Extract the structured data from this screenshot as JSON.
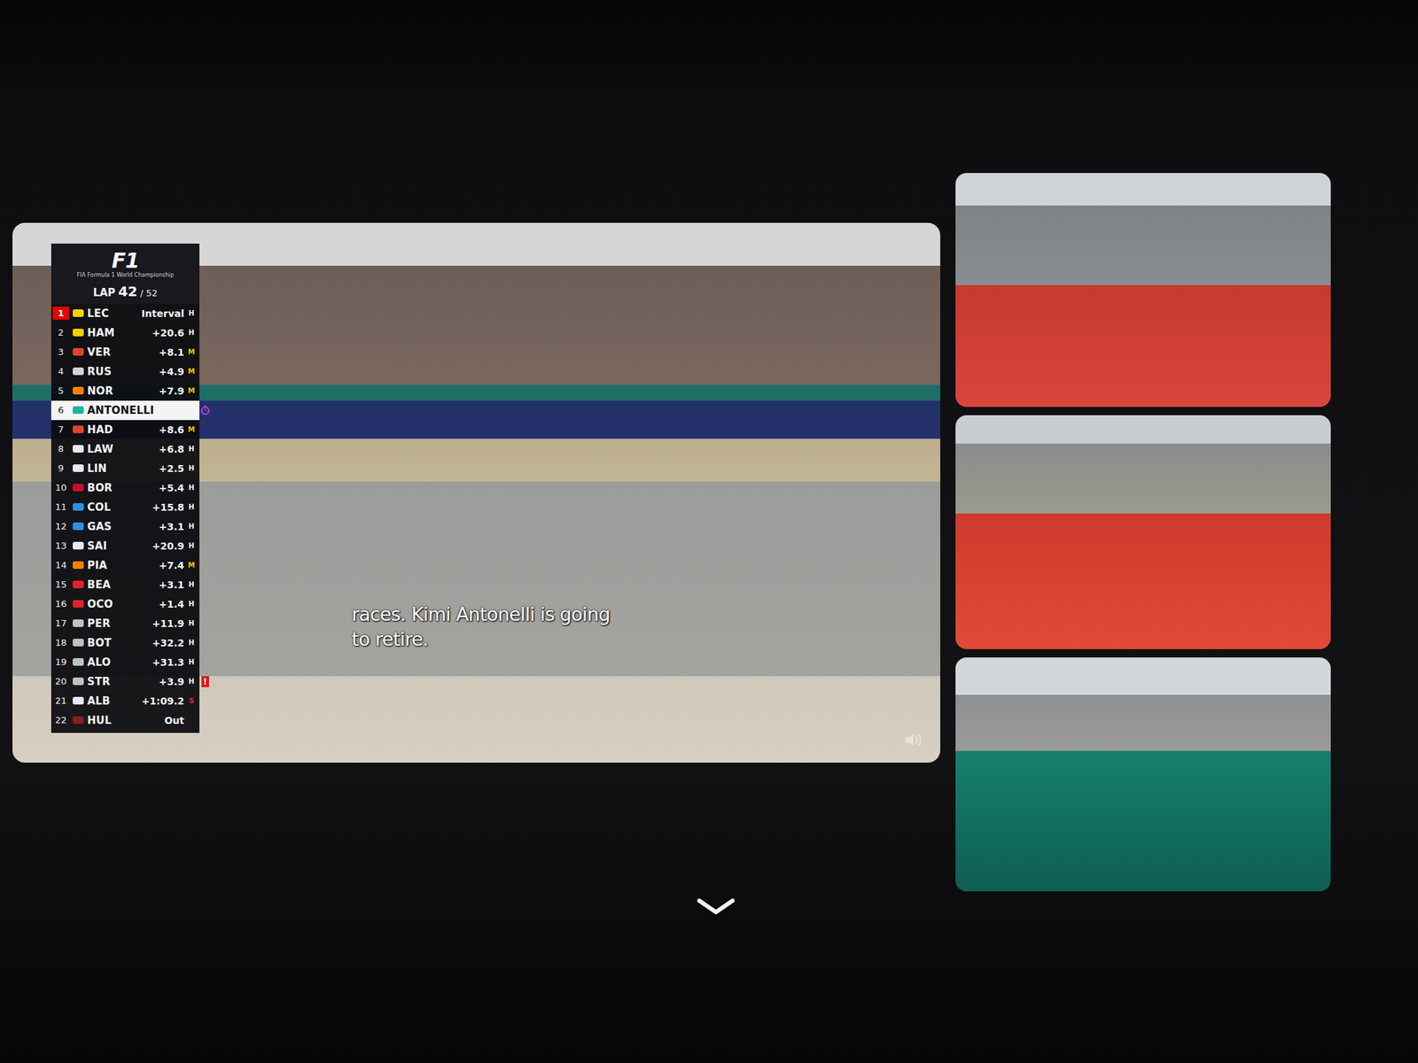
{
  "main_video": {
    "timing_tower": {
      "logo": "F1",
      "logo_subtitle": "FIA Formula 1 World Championship",
      "lap_label": "LAP",
      "lap_current": "42",
      "lap_total": "/ 52",
      "rows": [
        {
          "pos": "1",
          "code": "LEC",
          "interval": "Interval",
          "tyre": "H",
          "color": "#f5d000",
          "leader": true,
          "selected": false,
          "flag": "",
          "timer_icon": false
        },
        {
          "pos": "2",
          "code": "HAM",
          "interval": "+20.6",
          "tyre": "H",
          "color": "#f5d000",
          "leader": false,
          "selected": false,
          "flag": "",
          "timer_icon": false
        },
        {
          "pos": "3",
          "code": "VER",
          "interval": "+8.1",
          "tyre": "M",
          "color": "#e0442b",
          "leader": false,
          "selected": false,
          "flag": "",
          "timer_icon": false
        },
        {
          "pos": "4",
          "code": "RUS",
          "interval": "+4.9",
          "tyre": "M",
          "color": "#d0d4d8",
          "leader": false,
          "selected": false,
          "flag": "",
          "timer_icon": false
        },
        {
          "pos": "5",
          "code": "NOR",
          "interval": "+7.9",
          "tyre": "M",
          "color": "#ff8000",
          "leader": false,
          "selected": false,
          "flag": "",
          "timer_icon": false
        },
        {
          "pos": "6",
          "code": "ANTONELLI",
          "interval": "",
          "tyre": "",
          "color": "#1fb5a0",
          "leader": false,
          "selected": true,
          "flag": "",
          "timer_icon": true
        },
        {
          "pos": "7",
          "code": "HAD",
          "interval": "+8.6",
          "tyre": "M",
          "color": "#e0442b",
          "leader": false,
          "selected": false,
          "flag": "",
          "timer_icon": false
        },
        {
          "pos": "8",
          "code": "LAW",
          "interval": "+6.8",
          "tyre": "H",
          "color": "#e8e8f0",
          "leader": false,
          "selected": false,
          "flag": "",
          "timer_icon": false
        },
        {
          "pos": "9",
          "code": "LIN",
          "interval": "+2.5",
          "tyre": "H",
          "color": "#e8e8f0",
          "leader": false,
          "selected": false,
          "flag": "",
          "timer_icon": false
        },
        {
          "pos": "10",
          "code": "BOR",
          "interval": "+5.4",
          "tyre": "H",
          "color": "#c8102e",
          "leader": false,
          "selected": false,
          "flag": "",
          "timer_icon": false
        },
        {
          "pos": "11",
          "code": "COL",
          "interval": "+15.8",
          "tyre": "H",
          "color": "#2f8fe0",
          "leader": false,
          "selected": false,
          "flag": "",
          "timer_icon": false
        },
        {
          "pos": "12",
          "code": "GAS",
          "interval": "+3.1",
          "tyre": "H",
          "color": "#2f8fe0",
          "leader": false,
          "selected": false,
          "flag": "",
          "timer_icon": false
        },
        {
          "pos": "13",
          "code": "SAI",
          "interval": "+20.9",
          "tyre": "H",
          "color": "#e8e8ff",
          "leader": false,
          "selected": false,
          "flag": "",
          "timer_icon": false
        },
        {
          "pos": "14",
          "code": "PIA",
          "interval": "+7.4",
          "tyre": "M",
          "color": "#ff8000",
          "leader": false,
          "selected": false,
          "flag": "",
          "timer_icon": false
        },
        {
          "pos": "15",
          "code": "BEA",
          "interval": "+3.1",
          "tyre": "H",
          "color": "#e0222a",
          "leader": false,
          "selected": false,
          "flag": "",
          "timer_icon": false
        },
        {
          "pos": "16",
          "code": "OCO",
          "interval": "+1.4",
          "tyre": "H",
          "color": "#e0222a",
          "leader": false,
          "selected": false,
          "flag": "",
          "timer_icon": false
        },
        {
          "pos": "17",
          "code": "PER",
          "interval": "+11.9",
          "tyre": "H",
          "color": "#c0c0c0",
          "leader": false,
          "selected": false,
          "flag": "",
          "timer_icon": false
        },
        {
          "pos": "18",
          "code": "BOT",
          "interval": "+32.2",
          "tyre": "H",
          "color": "#c0c0c0",
          "leader": false,
          "selected": false,
          "flag": "",
          "timer_icon": false
        },
        {
          "pos": "19",
          "code": "ALO",
          "interval": "+31.3",
          "tyre": "H",
          "color": "#b8c4c0",
          "leader": false,
          "selected": false,
          "flag": "",
          "timer_icon": false
        },
        {
          "pos": "20",
          "code": "STR",
          "interval": "+3.9",
          "tyre": "H",
          "color": "#b8c4c0",
          "leader": false,
          "selected": false,
          "flag": "!",
          "timer_icon": false
        },
        {
          "pos": "21",
          "code": "ALB",
          "interval": "+1:09.2",
          "tyre": "S",
          "color": "#e8e8ff",
          "leader": false,
          "selected": false,
          "flag": "",
          "timer_icon": false
        },
        {
          "pos": "22",
          "code": "HUL",
          "interval": "Out",
          "tyre": "",
          "color": "#8a1c1c",
          "leader": false,
          "selected": false,
          "flag": "",
          "timer_icon": false
        }
      ]
    },
    "captions": [
      "races. Kimi Antonelli is going",
      "to retire."
    ],
    "muted": false
  }
}
